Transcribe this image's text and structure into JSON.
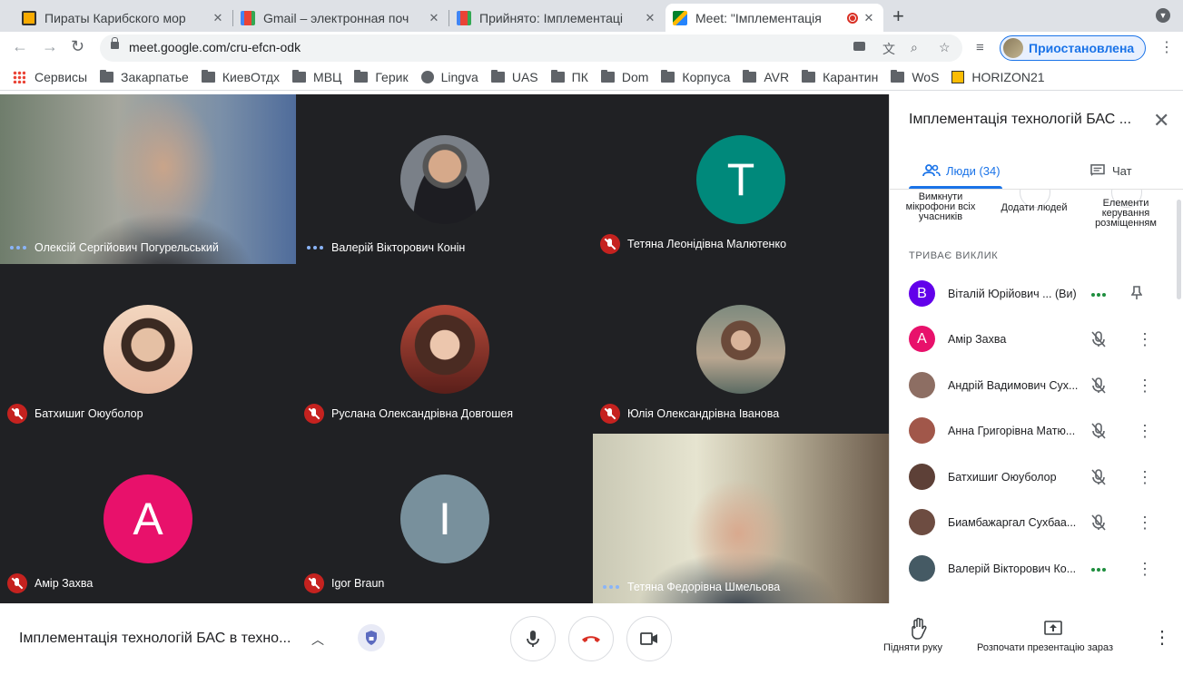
{
  "browser": {
    "tabs": [
      {
        "title": "Пираты Карибского мор",
        "favicon": "tv-icon",
        "color": "#f9ab00"
      },
      {
        "title": "Gmail – электронная поч",
        "favicon": "gmail-icon",
        "color": "#ea4335"
      },
      {
        "title": "Прийнято: Імплементаці",
        "favicon": "gmail-icon",
        "color": "#ea4335"
      },
      {
        "title": "Meet: \"Імплементація",
        "favicon": "meet-icon",
        "color": "#00832d"
      }
    ],
    "url": "meet.google.com/cru-efcn-odk",
    "profile_label": "Приостановлена",
    "bookmarks": [
      "Сервисы",
      "Закарпатье",
      "КиевОтдх",
      "МВЦ",
      "Герик",
      "Lingva",
      "UAS",
      "ПК",
      "Dom",
      "Корпуса",
      "AVR",
      "Карантин",
      "WoS",
      "HORIZON21"
    ]
  },
  "grid": {
    "tiles": [
      {
        "name": "Олексій Сергійович Погурельський",
        "state": "speaking",
        "kind": "video"
      },
      {
        "name": "Валерій Вікторович Конін",
        "state": "speaking",
        "kind": "photo"
      },
      {
        "name": "Тетяна Леонідівна Малютенко",
        "state": "muted",
        "kind": "letter",
        "letter": "Т",
        "color": "#00897b"
      },
      {
        "name": "Батхишиг Оюуболор",
        "state": "muted",
        "kind": "photo"
      },
      {
        "name": "Руслана Олександрівна Довгошея",
        "state": "muted",
        "kind": "photo"
      },
      {
        "name": "Юлія Олександрівна Іванова",
        "state": "muted",
        "kind": "photo"
      },
      {
        "name": "Амір Захва",
        "state": "muted",
        "kind": "letter",
        "letter": "A",
        "color": "#e8116b"
      },
      {
        "name": "Igor Braun",
        "state": "muted",
        "kind": "letter",
        "letter": "I",
        "color": "#78909c"
      },
      {
        "name": "Тетяна Федорівна Шмельова",
        "state": "speaking",
        "kind": "video"
      }
    ]
  },
  "panel": {
    "title": "Імплементація технологій БАС ...",
    "tab_people": "Люди (34)",
    "tab_chat": "Чат",
    "action_mute": "Вимкнути мікрофони всіх учасників",
    "action_add": "Додати людей",
    "action_layout": "Елементи керування розміщенням",
    "section": "ТРИВАЄ ВИКЛИК",
    "people": [
      {
        "name": "Віталій Юрійович ...",
        "suffix": "(Ви)",
        "letter": "В",
        "color": "#6200ea",
        "status": "speaking"
      },
      {
        "name": "Амір Захва",
        "letter": "A",
        "color": "#e8116b",
        "status": "muted"
      },
      {
        "name": "Андрій Вадимович Сух...",
        "letter": "",
        "color": "#8d6e63",
        "status": "muted"
      },
      {
        "name": "Анна Григорівна Матю...",
        "letter": "",
        "color": "#a1574a",
        "status": "muted"
      },
      {
        "name": "Батхишиг Оюуболор",
        "letter": "",
        "color": "#5d4037",
        "status": "muted"
      },
      {
        "name": "Биамбажаргал Сухбаа...",
        "letter": "",
        "color": "#6d4c41",
        "status": "muted"
      },
      {
        "name": "Валерій Вікторович Ко...",
        "letter": "",
        "color": "#455a64",
        "status": "speaking"
      }
    ]
  },
  "bottom": {
    "meeting_title": "Імплементація технологій БАС в техно...",
    "raise_hand": "Підняти руку",
    "present": "Розпочати презентацію зараз"
  }
}
